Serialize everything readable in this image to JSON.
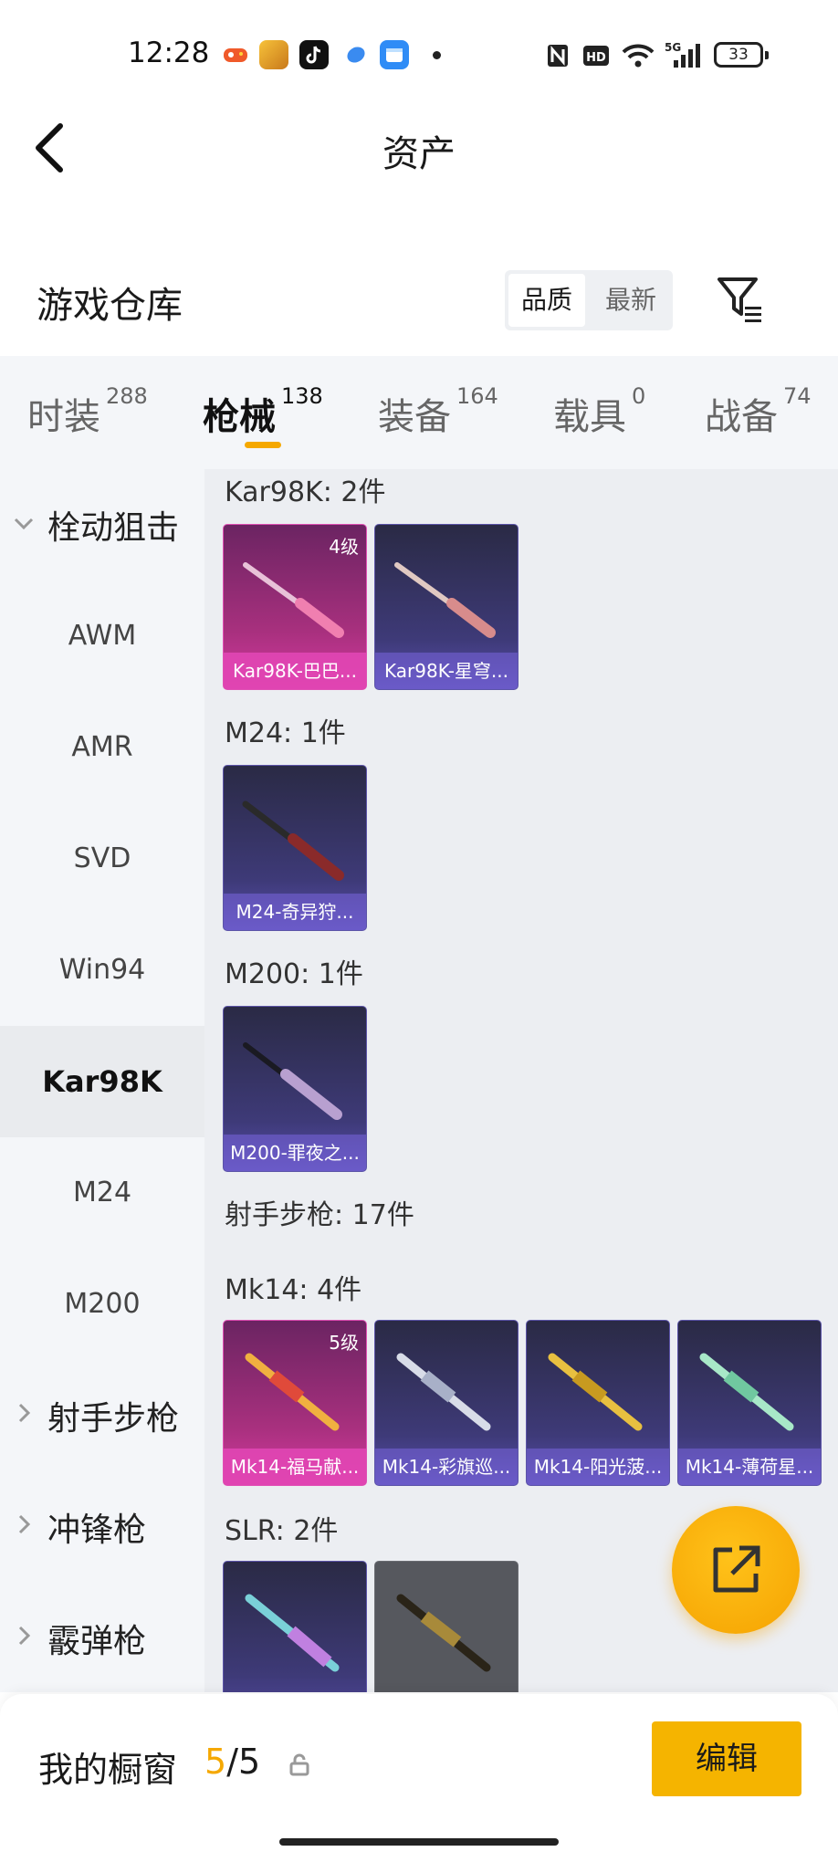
{
  "status": {
    "time": "12:28",
    "apps": [
      "game-icon",
      "gameforpeace-icon",
      "tiktok-icon",
      "message-icon",
      "calendar-icon"
    ],
    "right_icons": [
      "nfc-icon",
      "hd-icon",
      "wifi-icon",
      "5g-signal-icon"
    ],
    "battery": "33"
  },
  "header": {
    "title": "资产"
  },
  "warehouse": {
    "title": "游戏仓库",
    "sort_quality": "品质",
    "sort_newest": "最新"
  },
  "tabs": [
    {
      "label": "时装",
      "count": "288"
    },
    {
      "label": "枪械",
      "count": "138"
    },
    {
      "label": "装备",
      "count": "164"
    },
    {
      "label": "载具",
      "count": "0"
    },
    {
      "label": "战备",
      "count": "74"
    }
  ],
  "sidebar": {
    "bolt_sniper": "栓动狙击",
    "subs": [
      "AWM",
      "AMR",
      "SVD",
      "Win94",
      "Kar98K",
      "M24",
      "M200"
    ],
    "marksman": "射手步枪",
    "smg": "冲锋枪",
    "shotgun": "霰弹枪"
  },
  "groups": {
    "kar98k": "Kar98K: 2件",
    "m24": "M24: 1件",
    "m200": "M200: 1件",
    "marksman_total": "射手步枪: 17件",
    "mk14": "Mk14: 4件",
    "slr": "SLR: 2件"
  },
  "cards": {
    "kar_1": {
      "name": "Kar98K-巴巴...",
      "level": "4级"
    },
    "kar_2": {
      "name": "Kar98K-星穹..."
    },
    "m24_1": {
      "name": "M24-奇异狩..."
    },
    "m200_1": {
      "name": "M200-罪夜之..."
    },
    "mk14_1": {
      "name": "Mk14-福马献...",
      "level": "5级"
    },
    "mk14_2": {
      "name": "Mk14-彩旗巡..."
    },
    "mk14_3": {
      "name": "Mk14-阳光菠..."
    },
    "mk14_4": {
      "name": "Mk14-薄荷星..."
    }
  },
  "bottom": {
    "showcase": "我的橱窗",
    "count_used": "5",
    "count_total": "/5",
    "edit": "编辑"
  },
  "colors": {
    "accent": "#f5a800",
    "pink_rarity": "#d43aa0",
    "purple_rarity": "#5a4fb0"
  }
}
